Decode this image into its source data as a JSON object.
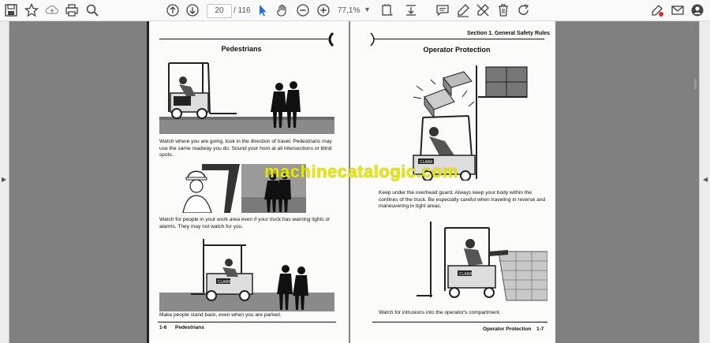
{
  "toolbar": {
    "page_number": "20",
    "page_total": "/ 116",
    "zoom_level": "77,1%"
  },
  "left_page": {
    "title": "Pedestrians",
    "paragraph1": "Watch where you are going, look in the direction of travel. Pedestrians may use the same roadway you do. Sound your horn at all intersections or blind spots.",
    "paragraph2": "Watch for people in your work area even if your truck has warning lights or alarms. They may not watch for you.",
    "paragraph3": "Make people stand back, even when you are parked.",
    "footer_page": "1-6",
    "footer_section": "Pedestrians"
  },
  "right_page": {
    "header": "Section 1. General Safety Rules",
    "title": "Operator Protection",
    "paragraph1": "Keep under the overhead guard. Always keep your body within the confines of the truck. Be especially careful when traveling in reverse and maneuvering in tight areas.",
    "paragraph2": "Watch for intrusions into the operator's compartment.",
    "footer_section": "Operator Protection",
    "footer_page": "1-7",
    "truck_brand": "CLARK"
  },
  "watermark": "machinecatalogic.com"
}
